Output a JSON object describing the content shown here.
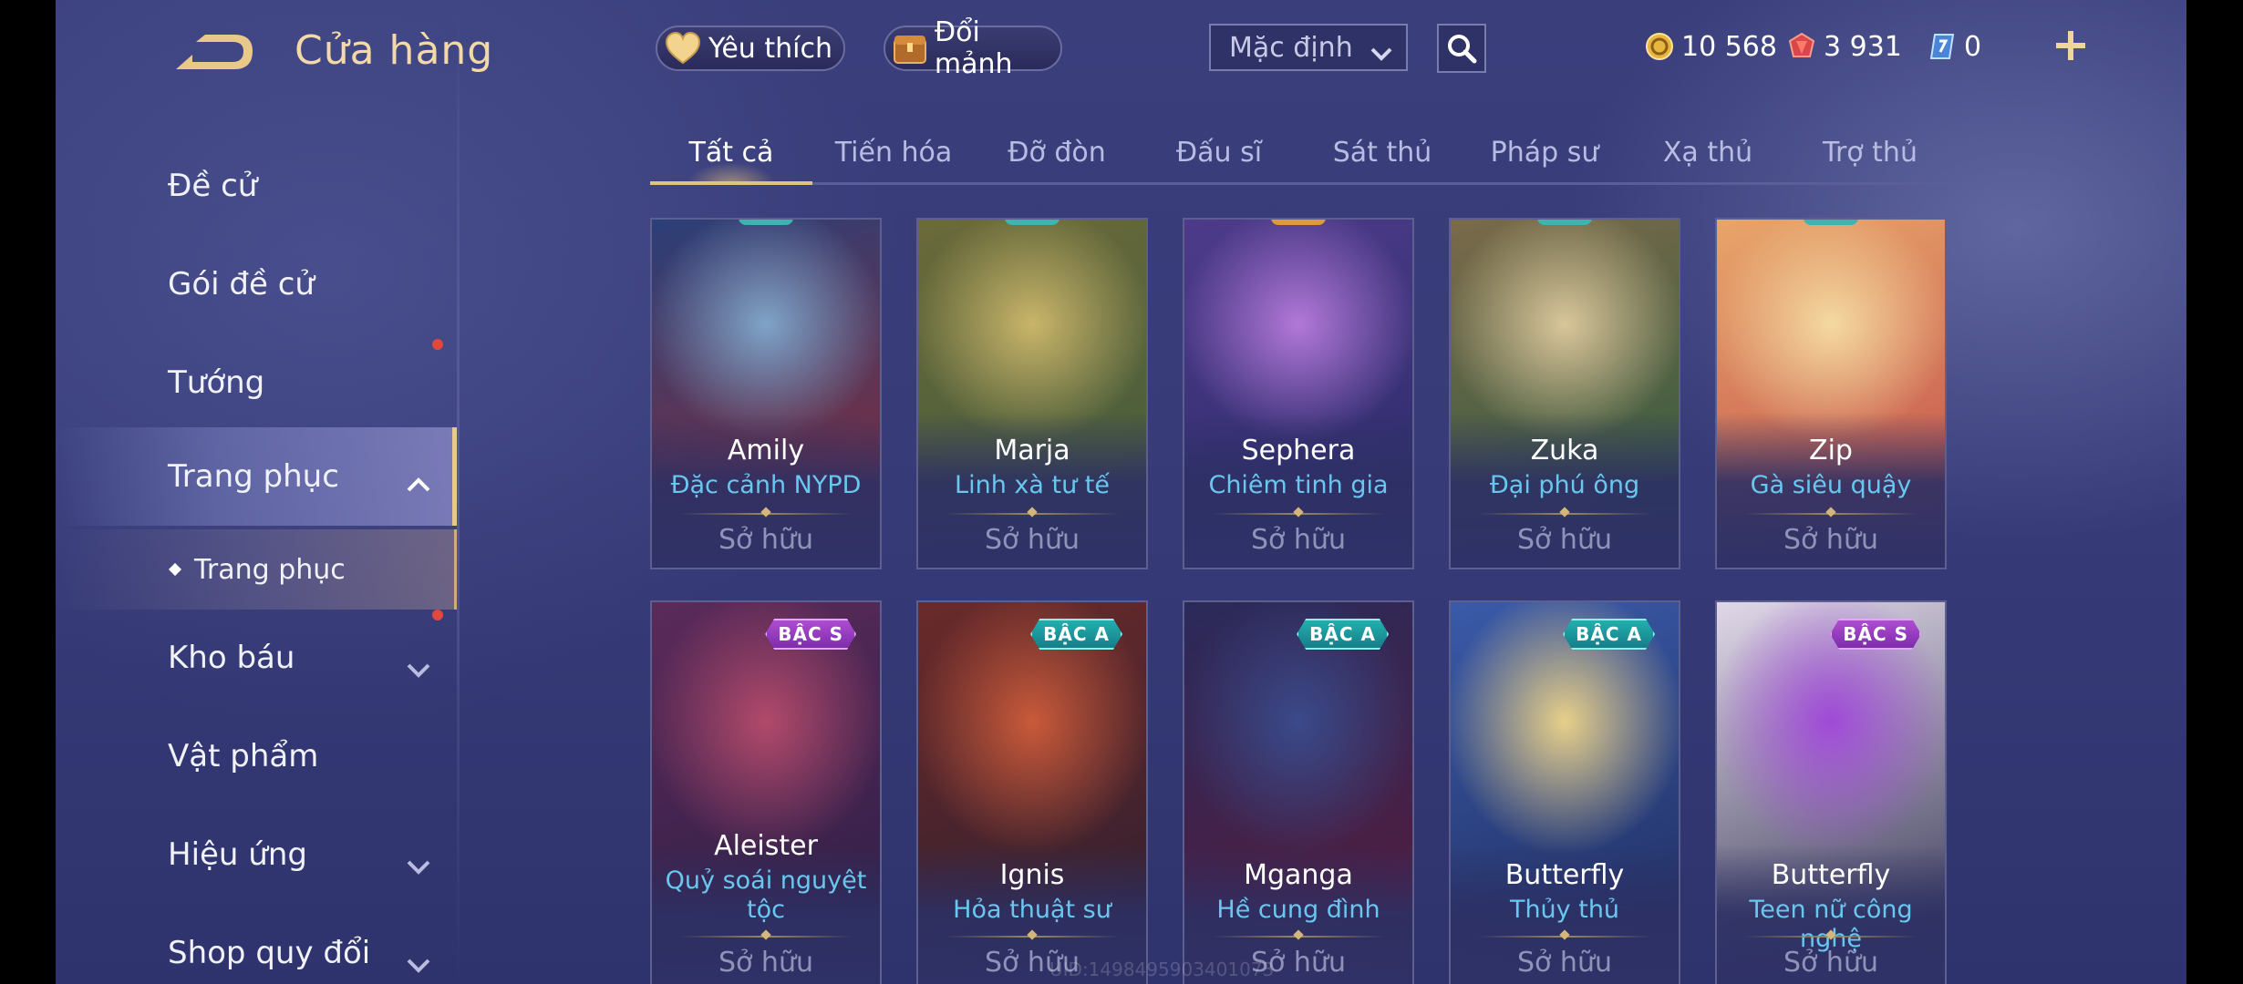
{
  "header": {
    "title": "Cửa hàng",
    "favorite_label": "Yêu thích",
    "exchange_label": "Đổi mảnh",
    "sort_selected": "Mặc định",
    "currencies": {
      "gold": "10 568",
      "ruby": "3 931",
      "voucher": "0"
    }
  },
  "sidebar": {
    "items": [
      {
        "label": "Đề cử"
      },
      {
        "label": "Gói đề cử"
      },
      {
        "label": "Tướng"
      },
      {
        "label": "Trang phục"
      },
      {
        "label": "Kho báu"
      },
      {
        "label": "Vật phẩm"
      },
      {
        "label": "Hiệu ứng"
      },
      {
        "label": "Shop quy đổi"
      }
    ],
    "sub_item": {
      "label": "Trang phục"
    }
  },
  "tabs": [
    {
      "label": "Tất cả"
    },
    {
      "label": "Tiến hóa"
    },
    {
      "label": "Đỡ đòn"
    },
    {
      "label": "Đấu sĩ"
    },
    {
      "label": "Sát thủ"
    },
    {
      "label": "Pháp sư"
    },
    {
      "label": "Xạ thủ"
    },
    {
      "label": "Trợ thủ"
    }
  ],
  "cards": [
    {
      "hero": "Amily",
      "skin": "Đặc cảnh NYPD",
      "status": "Sở hữu",
      "colors": [
        "#7fa3c7",
        "#2b3f78",
        "#8b2b35"
      ]
    },
    {
      "hero": "Marja",
      "skin": "Linh xà tư tế",
      "status": "Sở hữu",
      "colors": [
        "#c9b56a",
        "#6b6a3a",
        "#3f5a3c"
      ]
    },
    {
      "hero": "Sephera",
      "skin": "Chiêm tinh gia",
      "status": "Sở hữu",
      "colors": [
        "#b278d8",
        "#4d3b8a",
        "#2a2a68"
      ]
    },
    {
      "hero": "Zuka",
      "skin": "Đại phú ông",
      "status": "Sở hữu",
      "colors": [
        "#d9c69a",
        "#7a6a4a",
        "#2c5a3e"
      ]
    },
    {
      "hero": "Zip",
      "skin": "Gà siêu quậy",
      "status": "Sở hữu",
      "colors": [
        "#f4d9a0",
        "#e8a56a",
        "#c04a4a"
      ]
    },
    {
      "hero": "Aleister",
      "skin": "Quỷ soái nguyệt tộc",
      "status": "Sở hữu",
      "tier": "BẬC S",
      "colors": [
        "#b24a6a",
        "#5a2a5a",
        "#2a1e44"
      ]
    },
    {
      "hero": "Ignis",
      "skin": "Hỏa thuật sư",
      "status": "Sở hữu",
      "tier": "BẬC A",
      "colors": [
        "#c95a3a",
        "#6a2a2a",
        "#2a1e30"
      ]
    },
    {
      "hero": "Mganga",
      "skin": "Hề cung đình",
      "status": "Sở hữu",
      "tier": "BẬC A",
      "colors": [
        "#3a4a8a",
        "#2a2a5a",
        "#5a1a3a"
      ]
    },
    {
      "hero": "Butterfly",
      "skin": "Thủy thủ",
      "status": "Sở hữu",
      "tier": "BẬC A",
      "colors": [
        "#e8d08a",
        "#3a5aa8",
        "#1e2a5a"
      ]
    },
    {
      "hero": "Butterfly",
      "skin": "Teen nữ công nghệ",
      "status": "Sở hữu",
      "tier": "BẬC S",
      "colors": [
        "#a04ad8",
        "#e0d8e8",
        "#2a2a4a"
      ]
    }
  ],
  "watermark": "UID:1498495903401073",
  "colors": {
    "accent_gold": "#e2c27f",
    "skin_name": "#69c7ef",
    "notification_dot": "#e0483c"
  }
}
